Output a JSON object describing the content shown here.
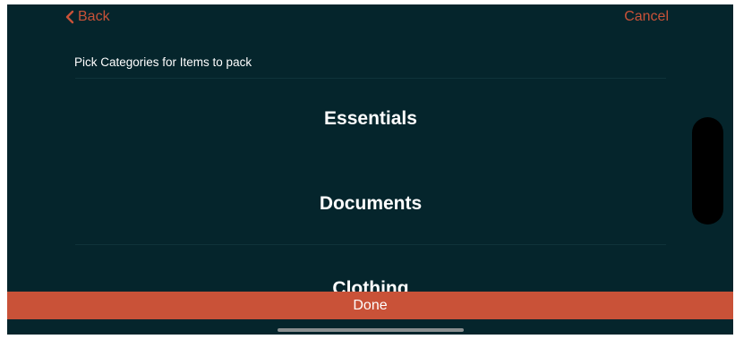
{
  "nav": {
    "back_label": "Back",
    "cancel_label": "Cancel"
  },
  "subtitle": "Pick Categories for Items to pack",
  "picker": {
    "items": [
      {
        "label": "Essentials"
      },
      {
        "label": "Documents"
      },
      {
        "label": "Clothing"
      }
    ]
  },
  "footer": {
    "done_label": "Done"
  },
  "colors": {
    "background": "#05252c",
    "accent": "#c95238",
    "text": "#ffffff"
  },
  "icons": {
    "back": "chevron-left-icon"
  }
}
